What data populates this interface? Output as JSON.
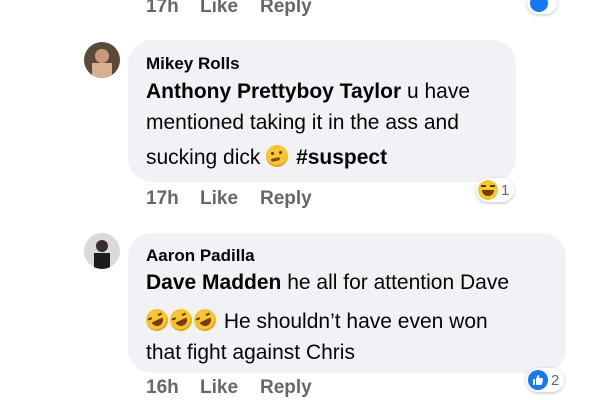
{
  "top": {
    "time": "17h",
    "like": "Like",
    "reply": "Reply"
  },
  "comments": [
    {
      "author": "Mikey Rolls",
      "mention": "Anthony Prettyboy Taylor",
      "line1_rest": " u have",
      "line2": "mentioned taking it in the ass and",
      "line3_text": "sucking dick ",
      "emoji": "thinking-face",
      "hashtag": "#suspect",
      "time": "17h",
      "like": "Like",
      "reply": "Reply",
      "reaction": {
        "type": "haha",
        "count": "1"
      }
    },
    {
      "author": "Aaron Padilla",
      "mention": "Dave Madden",
      "line1_rest": " he all for attention Dave",
      "emojis": [
        "rolling-on-floor-laughing",
        "rolling-on-floor-laughing",
        "rolling-on-floor-laughing"
      ],
      "line2_text": " He shouldn’t have even won",
      "line3": "that fight against Chris",
      "time": "16h",
      "like": "Like",
      "reply": "Reply",
      "reaction": {
        "type": "like",
        "count": "2"
      }
    }
  ],
  "colors": {
    "bubble": "#f0f2f5",
    "meta": "#65676b",
    "like_blue": "#1877f2"
  }
}
